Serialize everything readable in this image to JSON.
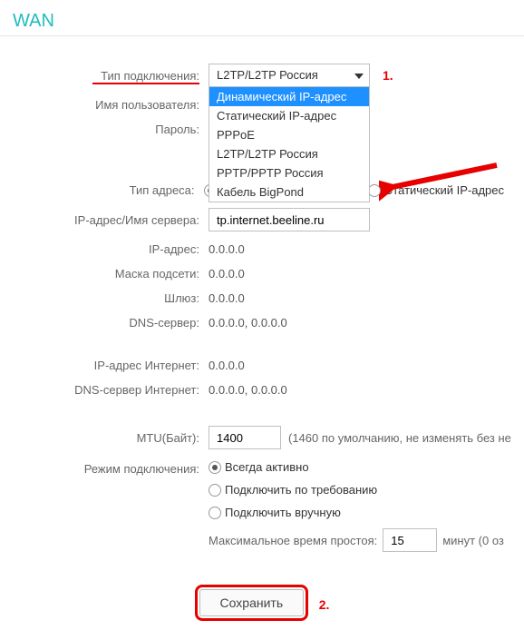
{
  "title": "WAN",
  "annotations": {
    "step1": "1.",
    "step2": "2."
  },
  "connection_type": {
    "label": "Тип подключения:",
    "selected": "L2TP/L2TP Россия",
    "options": [
      "Динамический IP-адрес",
      "Статический IP-адрес",
      "PPPoE",
      "L2TP/L2TP Россия",
      "PPTP/PPTP Россия",
      "Кабель BigPond"
    ]
  },
  "username": {
    "label": "Имя пользователя:"
  },
  "password": {
    "label": "Пароль:"
  },
  "address_type": {
    "label": "Тип адреса:",
    "dynamic": "Динамический IP-адрес",
    "static": "Статический IP-адрес"
  },
  "server": {
    "label": "IP-адрес/Имя сервера:",
    "value": "tp.internet.beeline.ru"
  },
  "ip": {
    "label": "IP-адрес:",
    "value": "0.0.0.0"
  },
  "mask": {
    "label": "Маска подсети:",
    "value": "0.0.0.0"
  },
  "gateway": {
    "label": "Шлюз:",
    "value": "0.0.0.0"
  },
  "dns": {
    "label": "DNS-сервер:",
    "value": "0.0.0.0,   0.0.0.0"
  },
  "ip_inet": {
    "label": "IP-адрес Интернет:",
    "value": "0.0.0.0"
  },
  "dns_inet": {
    "label": "DNS-сервер Интернет:",
    "value": "0.0.0.0,   0.0.0.0"
  },
  "mtu": {
    "label": "MTU(Байт):",
    "value": "1400",
    "helper": "(1460 по умолчанию, не изменять без не"
  },
  "mode": {
    "label": "Режим подключения:",
    "always": "Всегда активно",
    "ondemand": "Подключить по требованию",
    "manual": "Подключить вручную"
  },
  "idle": {
    "label": "Максимальное время простоя:",
    "value": "15",
    "suffix": "минут (0 оз"
  },
  "save": "Сохранить"
}
